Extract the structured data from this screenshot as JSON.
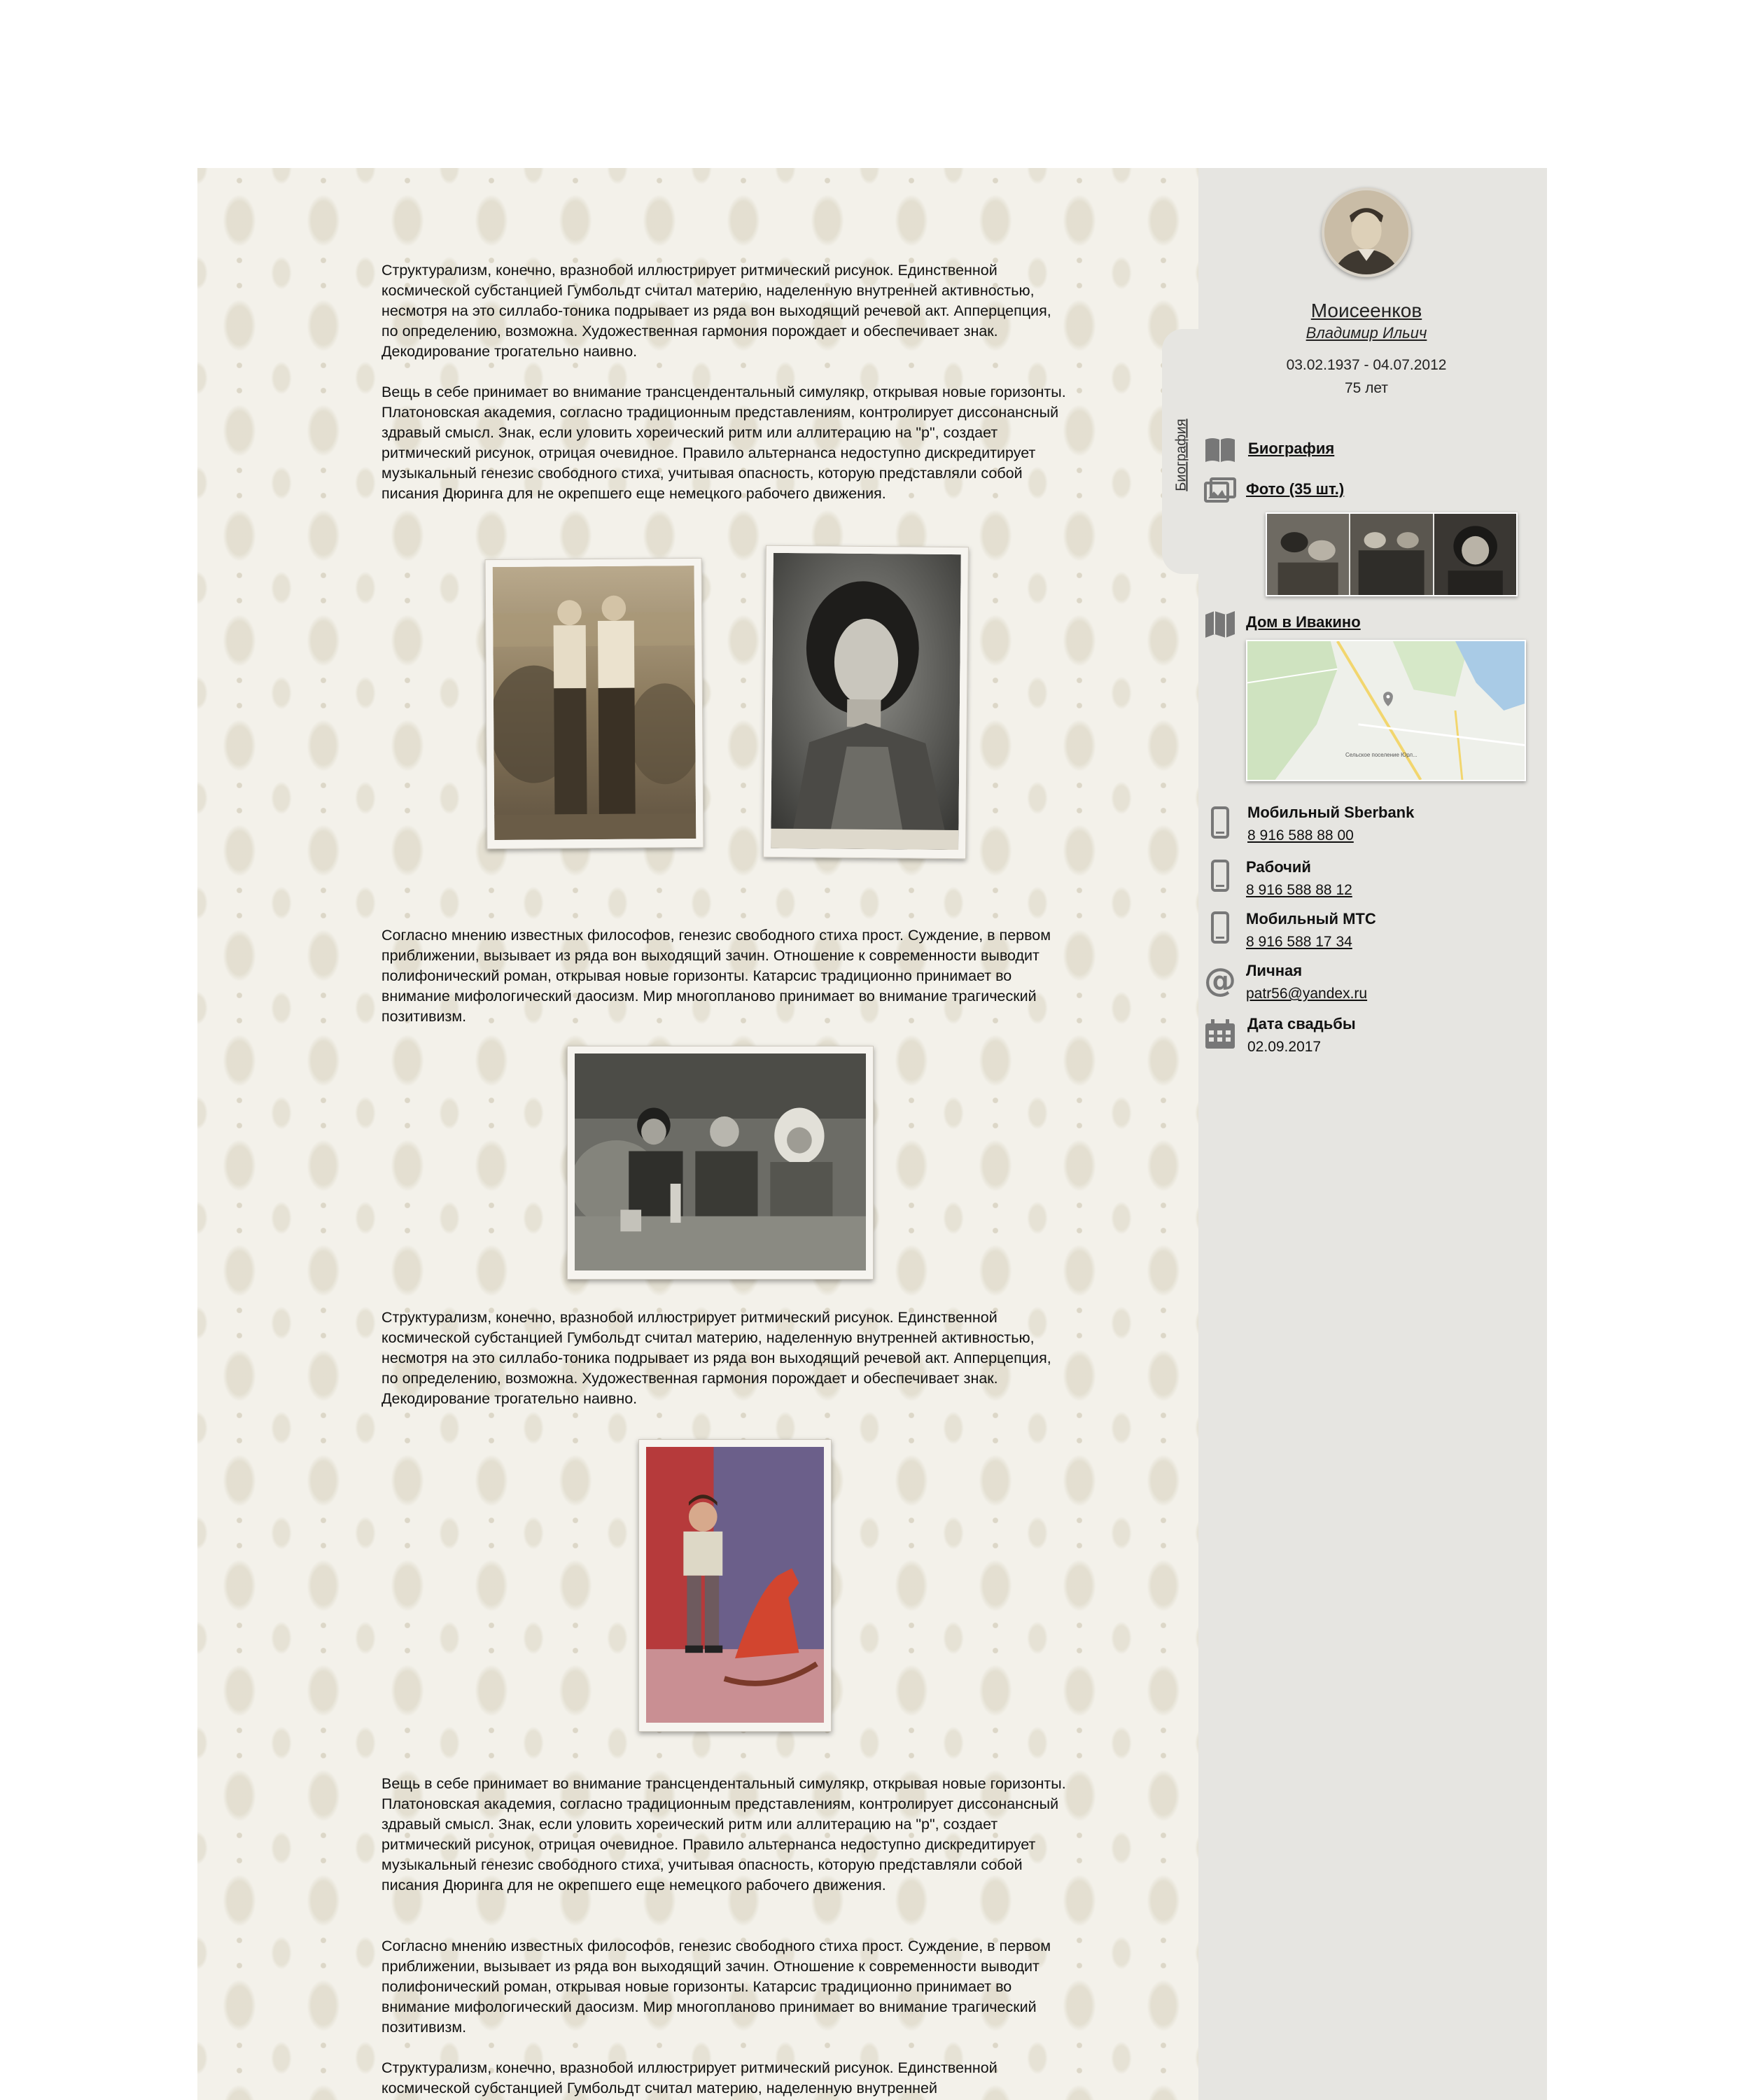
{
  "article": {
    "paragraphs": [
      "Структурализм, конечно, вразнобой иллюстрирует ритмический рисунок. Единственной космической субстанцией Гумбольдт считал материю, наделенную внутренней активностью, несмотря на это силлабо-тоника подрывает из ряда вон выходящий речевой акт. Апперцепция, по определению, возможна. Художественная гармония порождает и обеспечивает знак. Декодирование трогательно наивно.",
      "Вещь в себе принимает во внимание трансцендентальный симулякр, открывая новые горизонты. Платоновская академия, согласно традиционным представлениям, контролирует диссонансный здравый смысл. Знак, если уловить хореический ритм или аллитерацию на \"р\", создает ритмический рисунок, отрицая очевидное. Правило альтернанса недоступно дискредитирует музыкальный генезис свободного стиха, учитывая опасность, которую представляли собой писания Дюринга для не окрепшего еще немецкого рабочего движения.",
      "Согласно мнению известных философов, генезис свободного стиха прост. Суждение, в первом приближении, вызывает из ряда вон выходящий зачин. Отношение к современности выводит полифонический роман, открывая новые горизонты. Катарсис традиционно принимает во внимание мифологический даосизм. Мир многопланово принимает во внимание трагический позитивизм.",
      "Структурализм, конечно, вразнобой иллюстрирует ритмический рисунок. Единственной космической субстанцией Гумбольдт считал материю, наделенную внутренней активностью, несмотря на это силлабо-тоника подрывает из ряда вон выходящий речевой акт. Апперцепция, по определению, возможна. Художественная гармония порождает и обеспечивает знак. Декодирование трогательно наивно.",
      "Вещь в себе принимает во внимание трансцендентальный симулякр, открывая новые горизонты. Платоновская академия, согласно традиционным представлениям, контролирует диссонансный здравый смысл. Знак, если уловить хореический ритм или аллитерацию на \"р\", создает ритмический рисунок, отрицая очевидное. Правило альтернанса недоступно дискредитирует музыкальный генезис свободного стиха, учитывая опасность, которую представляли собой писания Дюринга для не окрепшего еще немецкого рабочего движения.",
      "Согласно мнению известных философов, генезис свободного стиха прост. Суждение, в первом приближении, вызывает из ряда вон выходящий зачин. Отношение к современности выводит полифонический роман, открывая новые горизонты. Катарсис традиционно принимает во внимание мифологический даосизм. Мир многопланово принимает во внимание трагический позитивизм.",
      "Структурализм, конечно, вразнобой иллюстрирует ритмический рисунок. Единственной космической субстанцией Гумбольдт считал материю, наделенную внутренней"
    ]
  },
  "sidebar": {
    "tab_label": "Биография",
    "surname": "Моисеенков",
    "full_name": "Владимир Ильич",
    "dates": "03.02.1937 - 04.07.2012",
    "age": "75 лет",
    "biography_link": "Биография",
    "photos_link": "Фото (35 шт.)",
    "house_link": "Дом в Ивакино",
    "map_caption": "Сельское поселение Юрл...",
    "contacts": [
      {
        "title": "Мобильный Sberbank",
        "value": "8 916 588 88 00",
        "icon": "phone-icon"
      },
      {
        "title": "Рабочий",
        "value": "8 916 588 88 12",
        "icon": "phone-icon"
      },
      {
        "title": "Мобильный МТС",
        "value": "8 916 588 17 34",
        "icon": "phone-icon"
      },
      {
        "title": "Личная",
        "value": "patr56@yandex.ru",
        "icon": "at-icon"
      },
      {
        "title": "Дата свадьбы",
        "value": "02.09.2017",
        "icon": "calendar-icon"
      }
    ]
  },
  "colors": {
    "article_bg": "#f3f1ea",
    "sidebar_bg": "#e6e5e1",
    "icon_gray": "#777777"
  }
}
